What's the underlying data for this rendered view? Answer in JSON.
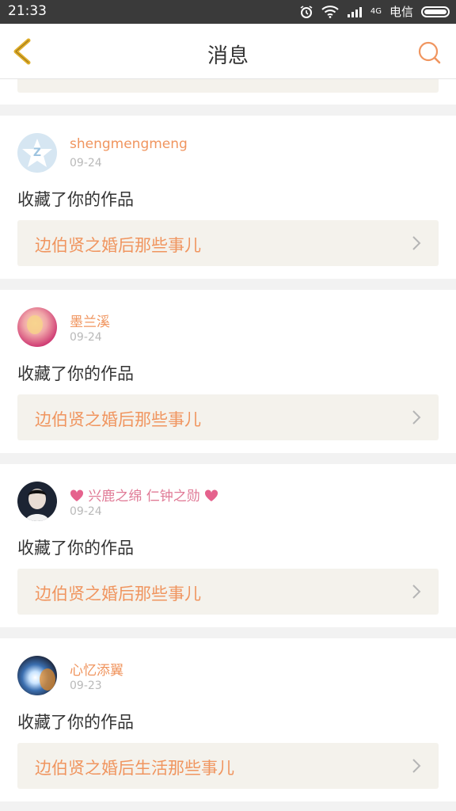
{
  "status_bar": {
    "time": "21:33",
    "network": "4G",
    "carrier": "电信"
  },
  "nav": {
    "title": "消息"
  },
  "messages": [
    {
      "user": "shengmengmeng",
      "date": "09-24",
      "action": "收藏了你的作品",
      "work_title": "边伯贤之婚后那些事儿"
    },
    {
      "user": "墨兰溪",
      "date": "09-24",
      "action": "收藏了你的作品",
      "work_title": "边伯贤之婚后那些事儿"
    },
    {
      "user": "兴鹿之绵 仁钟之勋",
      "date": "09-24",
      "action": "收藏了你的作品",
      "work_title": "边伯贤之婚后那些事儿"
    },
    {
      "user": "心忆添翼",
      "date": "09-23",
      "action": "收藏了你的作品",
      "work_title": "边伯贤之婚后生活那些事儿"
    }
  ],
  "colors": {
    "accent": "#f0955f",
    "pink": "#e07a96",
    "link_bg": "#f4f2ec",
    "back": "#e0ae2a"
  }
}
